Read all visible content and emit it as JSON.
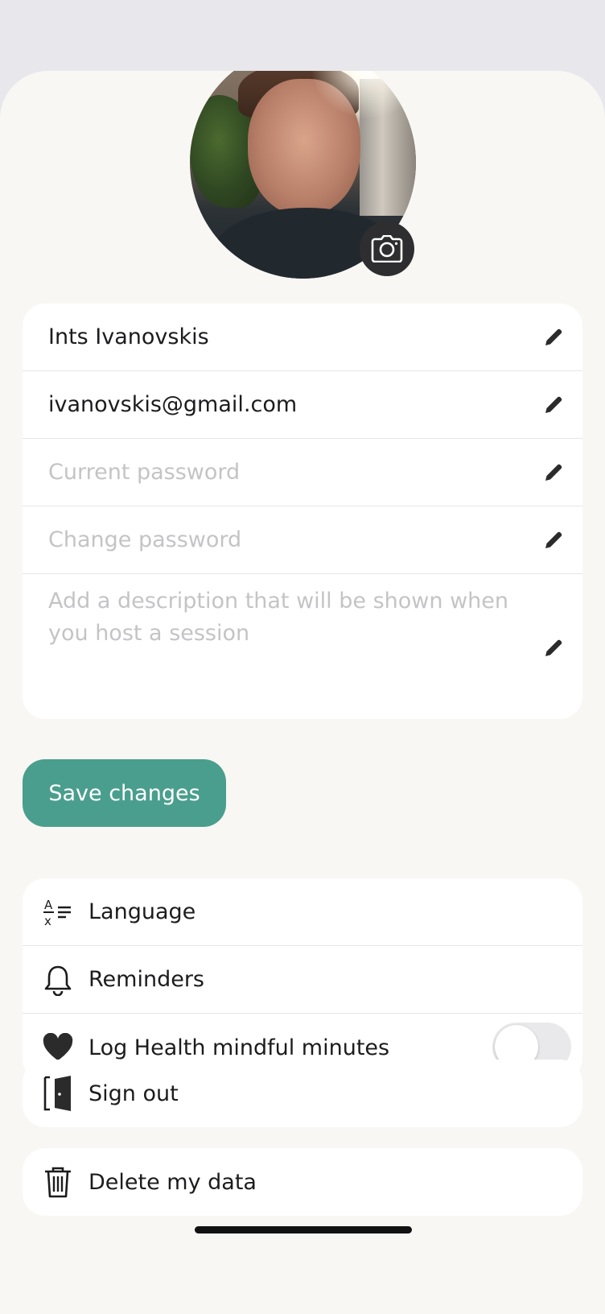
{
  "profile": {
    "name": "Ints Ivanovskis",
    "email": "ivanovskis@gmail.com",
    "current_password_placeholder": "Current password",
    "change_password_placeholder": "Change password",
    "description_placeholder": "Add a description that will be shown when you host a session",
    "save_label": "Save changes"
  },
  "settings": {
    "language_label": "Language",
    "reminders_label": "Reminders",
    "health_label": "Log Health mindful minutes",
    "health_toggle_on": false
  },
  "account": {
    "sign_out_label": "Sign out",
    "delete_label": "Delete my data"
  },
  "colors": {
    "accent": "#4a9e8d",
    "sheet_background": "#f8f7f4",
    "card_background": "#ffffff",
    "placeholder_text": "#c4c4c6"
  },
  "icons": {
    "camera": "camera-icon",
    "edit": "pencil-icon",
    "language": "translate-icon",
    "reminders": "bell-icon",
    "health": "heart-icon",
    "sign_out": "door-icon",
    "delete": "trash-icon"
  }
}
